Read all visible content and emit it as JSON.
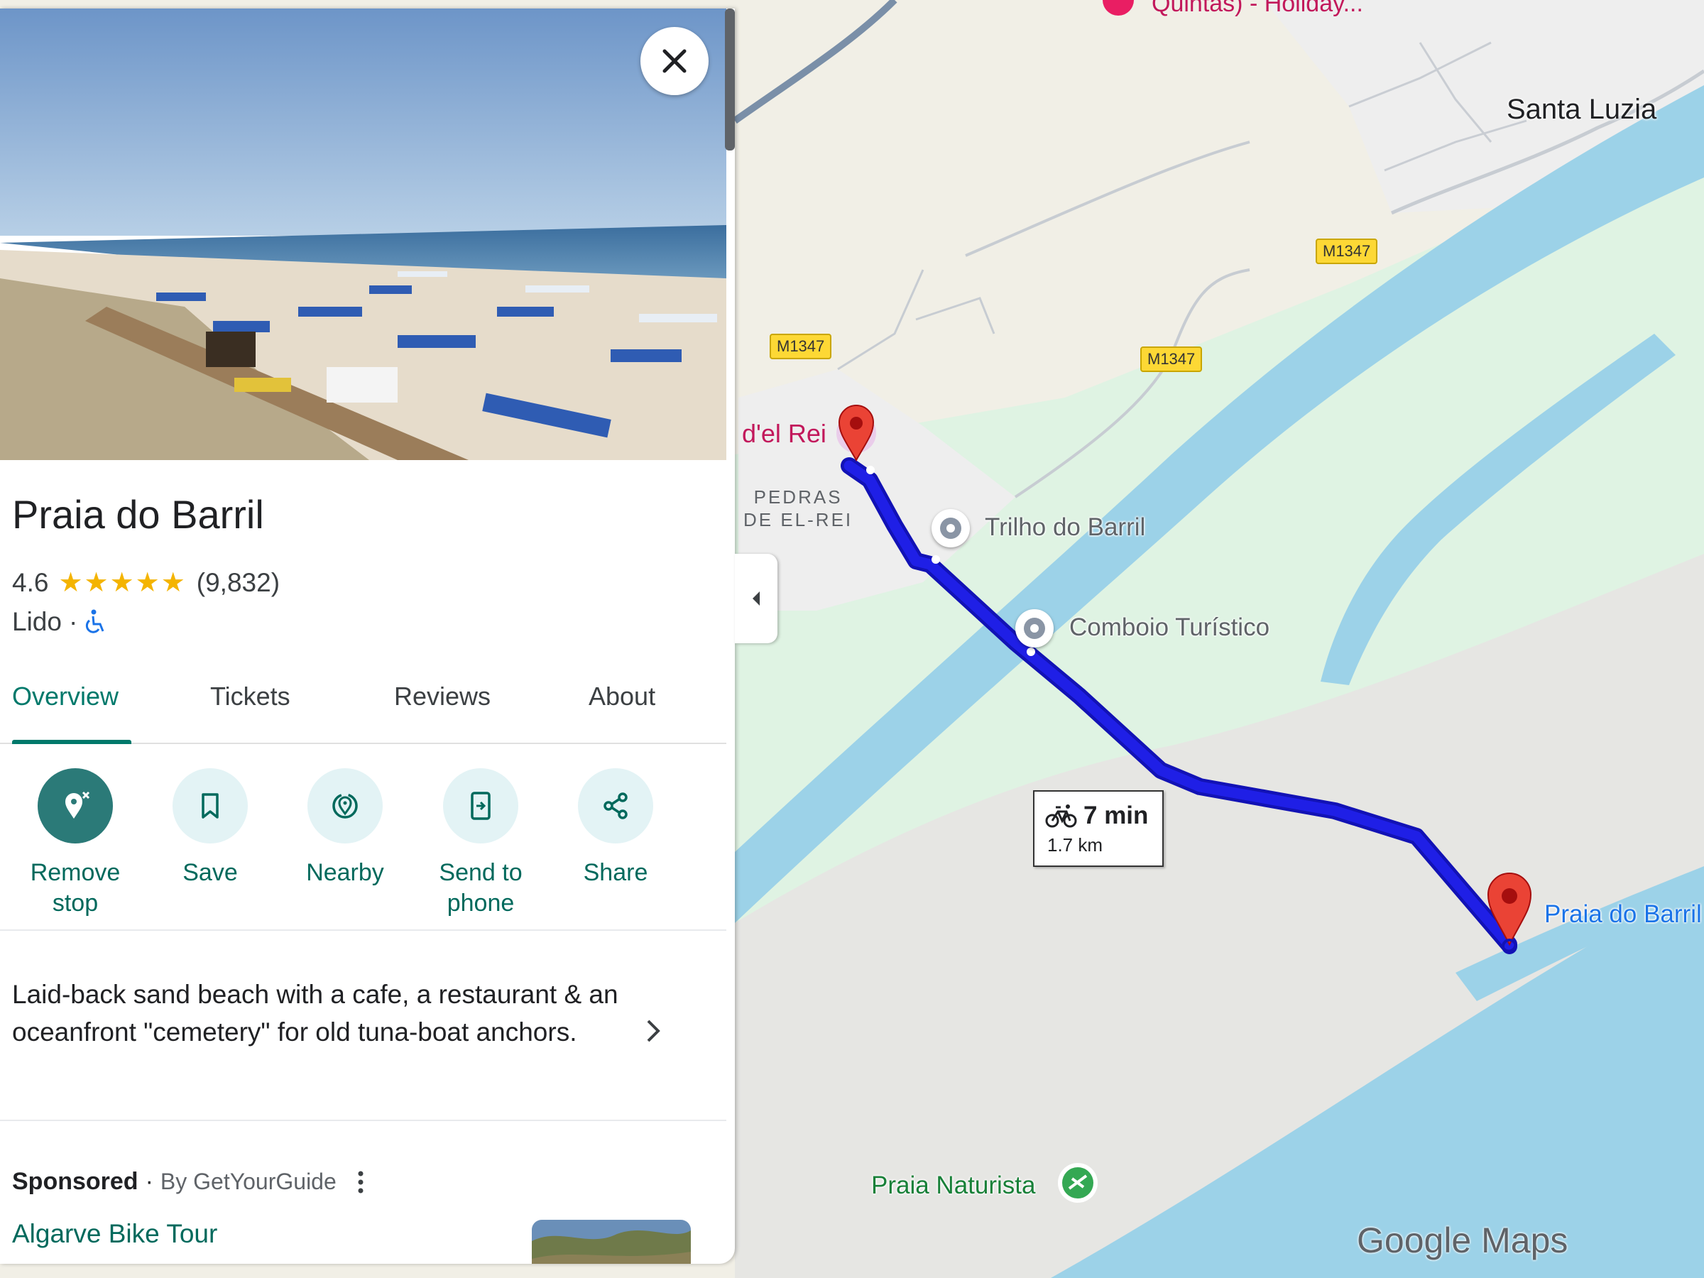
{
  "panel": {
    "title": "Praia do Barril",
    "rating": "4.6",
    "stars": "★★★★★",
    "review_count": "(9,832)",
    "category": "Lido",
    "category_sep": "·",
    "tabs": [
      {
        "label": "Overview"
      },
      {
        "label": "Tickets"
      },
      {
        "label": "Reviews"
      },
      {
        "label": "About"
      }
    ],
    "actions": {
      "remove_stop": "Remove stop",
      "save": "Save",
      "nearby": "Nearby",
      "send_to_phone": "Send to phone",
      "share": "Share"
    },
    "description": "Laid-back sand beach with a cafe, a restaurant & an oceanfront \"cemetery\" for old tuna-boat anchors.",
    "sponsored_label": "Sponsored",
    "sponsored_sep": "·",
    "sponsored_by": "By GetYourGuide",
    "ad_title": "Algarve Bike Tour"
  },
  "map": {
    "labels": {
      "top_label": "Quintas) - Holiday...",
      "santa_luzia": "Santa Luzia",
      "del_rei": "d'el Rei",
      "pedras_line1": "PEDRAS",
      "pedras_line2": "DE EL-REI",
      "trilho": "Trilho do Barril",
      "comboio": "Comboio Turístico",
      "praia_barril": "Praia do Barril",
      "praia_naturista": "Praia Naturista"
    },
    "road_shields": [
      "M1347",
      "M1347",
      "M1347"
    ],
    "route": {
      "time": "7 min",
      "distance": "1.7 km",
      "mode_icon": "bicycle-icon",
      "color": "#1a1aff"
    },
    "brand": "Google Maps"
  },
  "colors": {
    "accent": "#00796b",
    "water": "#9cd2e8",
    "land": "#e8f5e9",
    "sand": "#e6e6e3",
    "route": "#1f1fe6",
    "pin": "#ea4335"
  }
}
